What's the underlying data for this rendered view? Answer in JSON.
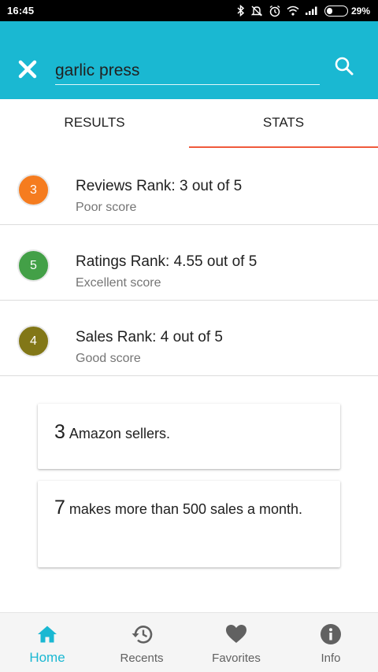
{
  "status_bar": {
    "time": "16:45",
    "battery": "29%",
    "battery_level": 0.29
  },
  "search": {
    "value": "garlic press",
    "placeholder": ""
  },
  "tabs": [
    {
      "label": "RESULTS",
      "active": false
    },
    {
      "label": "STATS",
      "active": true
    }
  ],
  "ranks": [
    {
      "badge": "3",
      "title": "Reviews Rank: 3 out of 5",
      "subtitle": "Poor score",
      "color": "#f57c1f"
    },
    {
      "badge": "5",
      "title": "Ratings Rank: 4.55 out of 5",
      "subtitle": "Excellent score",
      "color": "#43a047"
    },
    {
      "badge": "4",
      "title": "Sales Rank: 4 out of 5",
      "subtitle": "Good score",
      "color": "#827717"
    }
  ],
  "cards": [
    {
      "number": "3",
      "text": "Amazon sellers."
    },
    {
      "number": "7",
      "text": "makes more than 500 sales a month."
    }
  ],
  "bottom_nav": [
    {
      "label": "Home",
      "icon": "home-icon",
      "active": true
    },
    {
      "label": "Recents",
      "icon": "history-icon",
      "active": false
    },
    {
      "label": "Favorites",
      "icon": "heart-icon",
      "active": false
    },
    {
      "label": "Info",
      "icon": "info-icon",
      "active": false
    }
  ],
  "colors": {
    "primary": "#1ab8d2",
    "tab_indicator": "#f05a3c",
    "nav_inactive": "#616161"
  }
}
